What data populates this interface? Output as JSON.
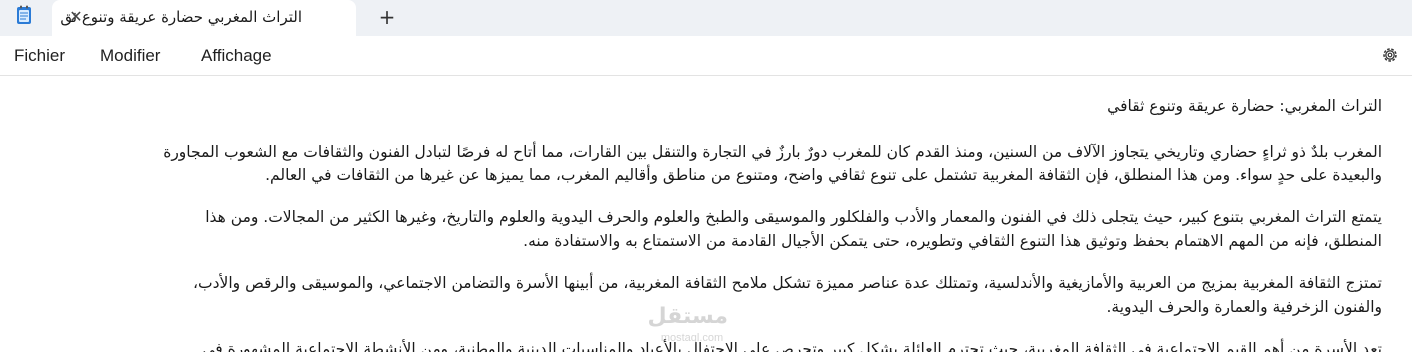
{
  "tab": {
    "title": "التراث المغربي حضارة عريقة وتنوع ثق",
    "close_symbol": "✕"
  },
  "new_tab_symbol": "+",
  "menu": {
    "file": "Fichier",
    "edit": "Modifier",
    "view": "Affichage"
  },
  "icons": {
    "app": "notepad-icon",
    "settings": "gear-icon"
  },
  "document": {
    "lines": [
      "التراث المغربي: حضارة عريقة وتنوع ثقافي",
      "المغرب بلدٌ ذو ثراءٍ حضاري وتاريخي يتجاوز الآلاف من السنين، ومنذ القدم كان للمغرب دورٌ بارزٌ في التجارة والتنقل بين القارات، مما أتاح له فرصًا لتبادل الفنون والثقافات مع الشعوب المجاورة",
      "والبعيدة على حدٍ سواء. ومن هذا المنطلق، فإن الثقافة المغربية تشتمل على تنوع ثقافي واضح، ومتنوع من مناطق وأقاليم المغرب، مما يميزها عن غيرها من الثقافات في العالم.",
      "يتمتع التراث المغربي بتنوع كبير، حيث يتجلى ذلك في الفنون والمعمار والأدب والفلكلور والموسيقى والطبخ والعلوم والحرف اليدوية والعلوم والتاريخ، وغيرها الكثير من المجالات. ومن هذا",
      "المنطلق، فإنه من المهم الاهتمام بحفظ وتوثيق هذا التنوع الثقافي وتطويره، حتى يتمكن الأجيال القادمة من الاستمتاع به والاستفادة منه.",
      "تمتزج الثقافة المغربية بمزيج من العربية والأمازيغية والأندلسية، وتمتلك عدة عناصر مميزة تشكل ملامح الثقافة المغربية، من أبينها الأسرة والتضامن الاجتماعي، والموسيقى والرقص والأدب،",
      "والفنون الزخرفية والعمارة والحرف اليدوية.",
      "تعد الأسرة من أهم القيم الاجتماعية في الثقافة المغربية، حيث تحترم العائلة بشكل كبير وتحرص على الاحتفال بالأعياد والمناسبات الدينية والوطنية، ومن الأنشطة الاجتماعية المشهورة في"
    ]
  },
  "watermark": {
    "arabic": "مستقل",
    "latin": "mostaql.com"
  }
}
